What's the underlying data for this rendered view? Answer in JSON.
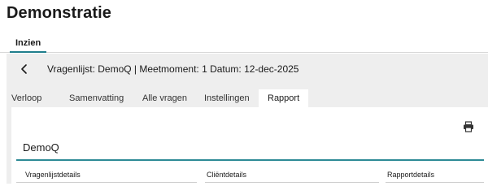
{
  "page": {
    "title": "Demonstratie"
  },
  "top_tabs": [
    {
      "label": "Inzien",
      "active": true
    }
  ],
  "header": {
    "back_icon": "chevron-left-icon",
    "text": "Vragenlijst: DemoQ | Meetmoment: 1 Datum: 12-dec-2025"
  },
  "tabs": [
    {
      "label": "Verloop",
      "active": false
    },
    {
      "label": "Samenvatting",
      "active": false
    },
    {
      "label": "Alle vragen",
      "active": false
    },
    {
      "label": "Instellingen",
      "active": false
    },
    {
      "label": "Rapport",
      "active": true
    }
  ],
  "report": {
    "print_icon": "printer-icon",
    "title": "DemoQ",
    "columns": [
      {
        "label": "Vragenlijstdetails"
      },
      {
        "label": "Cliëntdetails"
      },
      {
        "label": "Rapportdetails"
      }
    ]
  },
  "colors": {
    "accent": "#1f7e8c",
    "panel_bg": "#eeeeee"
  }
}
